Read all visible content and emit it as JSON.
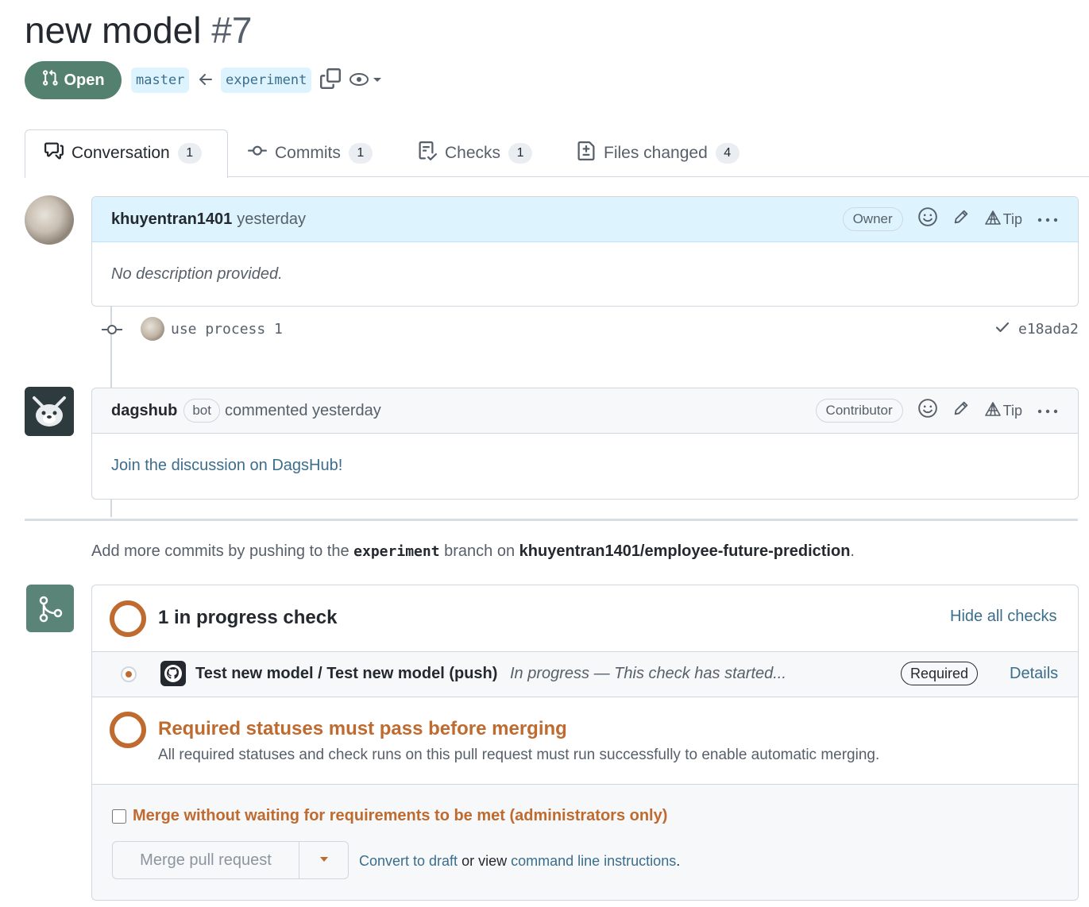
{
  "pr": {
    "title": "new model",
    "number": "#7",
    "state": "Open",
    "base_branch": "master",
    "head_branch": "experiment"
  },
  "tabs": [
    {
      "label": "Conversation",
      "count": "1"
    },
    {
      "label": "Commits",
      "count": "1"
    },
    {
      "label": "Checks",
      "count": "1"
    },
    {
      "label": "Files changed",
      "count": "4"
    }
  ],
  "comment1": {
    "author": "khuyentran1401",
    "time": "yesterday",
    "role": "Owner",
    "tip": "Tip",
    "body": "No description provided."
  },
  "commit": {
    "message": "use process 1",
    "sha": "e18ada2"
  },
  "comment2": {
    "author": "dagshub",
    "bot_label": "bot",
    "action": "commented yesterday",
    "role": "Contributor",
    "tip": "Tip",
    "body": "Join the discussion on DagsHub!"
  },
  "push_hint": {
    "prefix": "Add more commits by pushing to the",
    "branch": "experiment",
    "middle": "branch on",
    "repo": "khuyentran1401/employee-future-prediction",
    "suffix": "."
  },
  "checks": {
    "summary": "1 in progress check",
    "hide_label": "Hide all checks",
    "item_name": "Test new model / Test new model (push)",
    "item_status": "In progress — This check has started...",
    "required_label": "Required",
    "details_label": "Details"
  },
  "requirements": {
    "title": "Required statuses must pass before merging",
    "description": "All required statuses and check runs on this pull request must run successfully to enable automatic merging."
  },
  "merge": {
    "bypass_label": "Merge without waiting for requirements to be met (administrators only)",
    "button_label": "Merge pull request",
    "draft_link": "Convert to draft",
    "or_view": "or view",
    "cli_link": "command line instructions",
    "period": "."
  },
  "colors": {
    "open_state": "#54806f",
    "pending": "#bf6a2f",
    "link": "#3b6d8c",
    "owner_header_bg": "#ddf4ff"
  }
}
